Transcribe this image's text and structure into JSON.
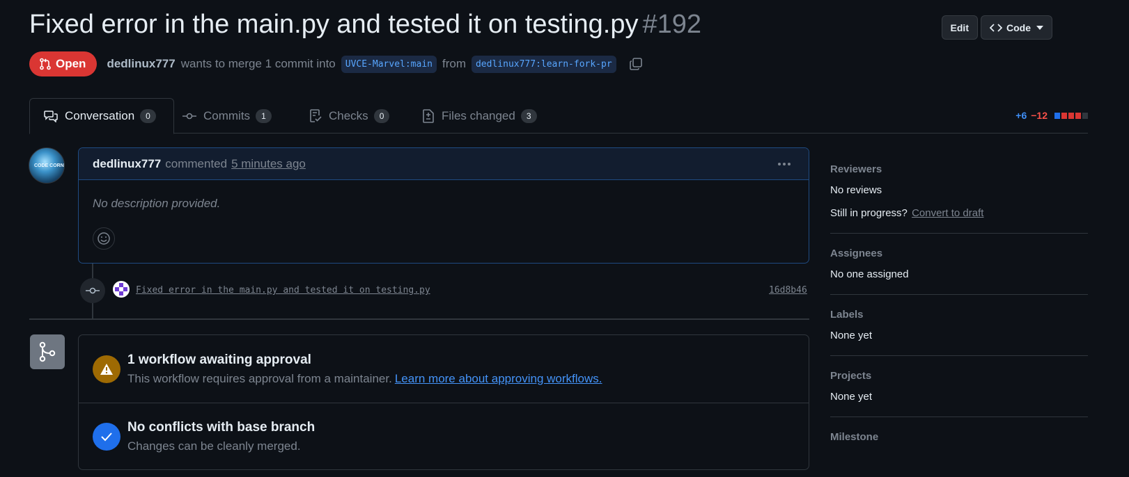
{
  "pr": {
    "title": "Fixed error in the main.py and tested it on testing.py",
    "number": "#192",
    "state": "Open",
    "author": "dedlinux777",
    "merge_text": "wants to merge 1 commit into",
    "base_branch": "UVCE-Marvel:main",
    "from_text": "from",
    "head_branch": "dedlinux777:learn-fork-pr"
  },
  "header_actions": {
    "edit": "Edit",
    "code": "Code"
  },
  "tabs": [
    {
      "label": "Conversation",
      "count": "0"
    },
    {
      "label": "Commits",
      "count": "1"
    },
    {
      "label": "Checks",
      "count": "0"
    },
    {
      "label": "Files changed",
      "count": "3"
    }
  ],
  "diffstat": {
    "additions": "+6",
    "deletions": "−12",
    "blocks": [
      "#1f6feb",
      "#da3633",
      "#da3633",
      "#da3633",
      "#30363d"
    ]
  },
  "comment": {
    "author": "dedlinux777",
    "action": "commented",
    "timestamp": "5 minutes ago",
    "body": "No description provided."
  },
  "commit": {
    "message": "Fixed error in the main.py and tested it on testing.py",
    "sha": "16d8b46"
  },
  "avatar": {
    "text": "CODE CORN"
  },
  "merge": {
    "workflow_title": "1 workflow awaiting approval",
    "workflow_desc": "This workflow requires approval from a maintainer.",
    "workflow_link": "Learn more about approving workflows.",
    "conflict_title": "No conflicts with base branch",
    "conflict_desc": "Changes can be cleanly merged."
  },
  "sidebar": {
    "reviewers": {
      "heading": "Reviewers",
      "value": "No reviews",
      "progress_text": "Still in progress?",
      "convert_link": "Convert to draft"
    },
    "assignees": {
      "heading": "Assignees",
      "value": "No one assigned"
    },
    "labels": {
      "heading": "Labels",
      "value": "None yet"
    },
    "projects": {
      "heading": "Projects",
      "value": "None yet"
    },
    "milestone": {
      "heading": "Milestone"
    }
  },
  "colors": {
    "open": "#da3633",
    "warning": "#9e6a03",
    "success": "#1f6feb",
    "link": "#4493f8"
  }
}
